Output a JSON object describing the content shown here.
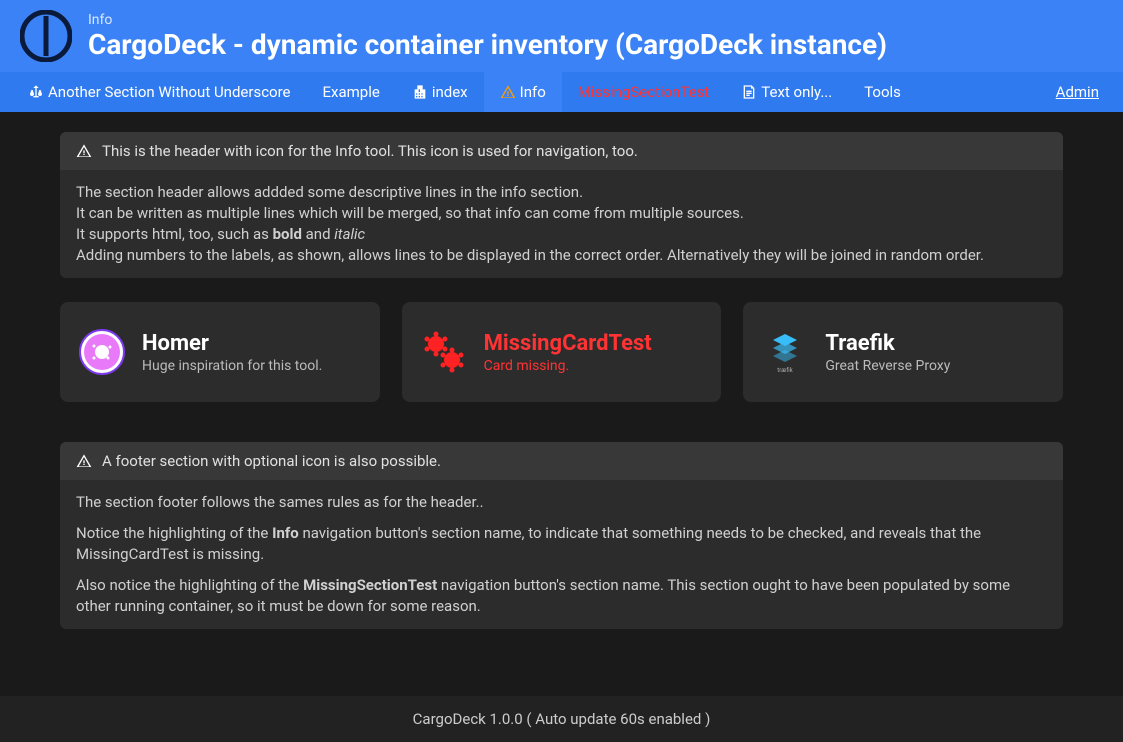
{
  "header": {
    "pretitle": "Info",
    "title": "CargoDeck - dynamic container inventory (CargoDeck instance)"
  },
  "nav": {
    "items": [
      {
        "label": "Another Section Without Underscore",
        "icon": "scale-icon",
        "active": false,
        "warning": false
      },
      {
        "label": "Example",
        "icon": null,
        "active": false,
        "warning": false
      },
      {
        "label": "index",
        "icon": "building-icon",
        "active": false,
        "warning": false
      },
      {
        "label": "Info",
        "icon": "warning-icon",
        "active": true,
        "warning": false,
        "warning_icon": true
      },
      {
        "label": "MissingSectionTest",
        "icon": null,
        "active": false,
        "warning": true
      },
      {
        "label": "Text only...",
        "icon": "document-icon",
        "active": false,
        "warning": false
      },
      {
        "label": "Tools",
        "icon": null,
        "active": false,
        "warning": false
      }
    ],
    "admin": "Admin"
  },
  "info_header": {
    "text": "This is the header with icon for the Info tool. This icon is used for navigation, too."
  },
  "info_body": {
    "line1": "The section header allows addded some descriptive lines in the info section.",
    "line2": "It can be written as multiple lines which will be merged, so that info can come from multiple sources.",
    "line3_prefix": "It supports html, too, such as ",
    "line3_bold": "bold",
    "line3_mid": " and ",
    "line3_italic": "italic",
    "line4": "Adding numbers to the labels, as shown, allows lines to be displayed in the correct order. Alternatively they will be joined in random order."
  },
  "cards": [
    {
      "title": "Homer",
      "subtitle": "Huge inspiration for this tool.",
      "icon": "donut-icon",
      "missing": false
    },
    {
      "title": "MissingCardTest",
      "subtitle": "Card missing.",
      "icon": "virus-icon",
      "missing": true
    },
    {
      "title": "Traefik",
      "subtitle": "Great Reverse Proxy",
      "icon": "traefik-icon",
      "missing": false
    }
  ],
  "info_footer_header": {
    "text": "A footer section with optional icon is also possible."
  },
  "info_footer_body": {
    "p1": "The section footer follows the sames rules as for the header..",
    "p2_prefix": "Notice the highlighting of the ",
    "p2_bold": "Info",
    "p2_suffix": " navigation button's section name, to indicate that something needs to be checked, and reveals that the MissingCardTest is missing.",
    "p3_prefix": "Also notice the highlighting of the ",
    "p3_bold": "MissingSectionTest",
    "p3_suffix": " navigation button's section name. This section ought to have been populated by some other running container, so it must be down for some reason."
  },
  "footer": {
    "text": "CargoDeck 1.0.0 ( Auto update 60s enabled )"
  }
}
